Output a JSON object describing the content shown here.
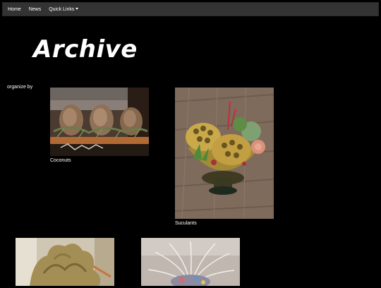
{
  "nav": {
    "items": [
      {
        "label": "Home"
      },
      {
        "label": "News"
      },
      {
        "label": "Quick Links"
      }
    ]
  },
  "page": {
    "title": "Archive",
    "organize_label": "organize by"
  },
  "gallery": {
    "items": [
      {
        "caption": "Coconuts"
      },
      {
        "caption": "Suculants"
      },
      {
        "caption": ""
      },
      {
        "caption": ""
      }
    ]
  }
}
